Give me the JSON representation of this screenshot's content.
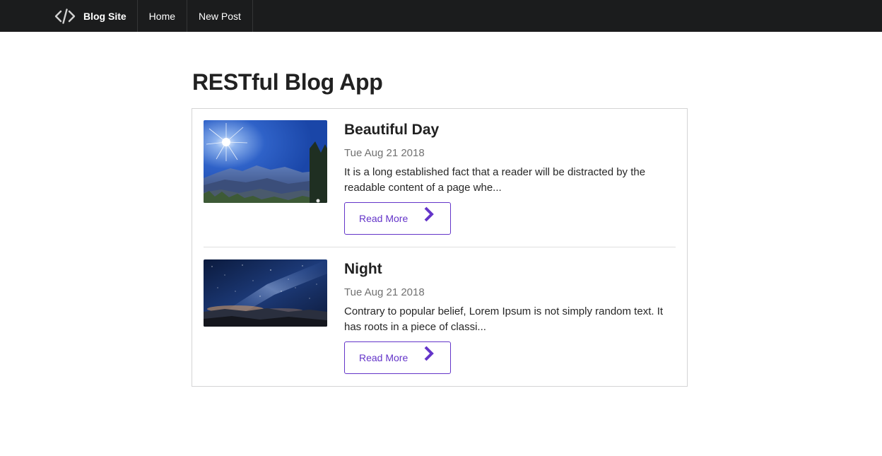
{
  "navbar": {
    "brand_label": "Blog Site",
    "brand_icon": "code-icon",
    "items": [
      {
        "label": "Home"
      },
      {
        "label": "New Post"
      }
    ]
  },
  "main": {
    "title": "RESTful Blog App",
    "posts": [
      {
        "title": "Beautiful Day",
        "date": "Tue Aug 21 2018",
        "excerpt": "It is a long established fact that a reader will be distracted by the readable content of a page whe...",
        "button_label": "Read More",
        "button_icon": "chevron-right-icon"
      },
      {
        "title": "Night",
        "date": "Tue Aug 21 2018",
        "excerpt": "Contrary to popular belief, Lorem Ipsum is not simply random text. It has roots in a piece of classi...",
        "button_label": "Read More",
        "button_icon": "chevron-right-icon"
      }
    ]
  },
  "colors": {
    "navbar_bg": "#1b1c1d",
    "accent": "#6435c9",
    "text": "#212121",
    "meta": "#717171"
  }
}
